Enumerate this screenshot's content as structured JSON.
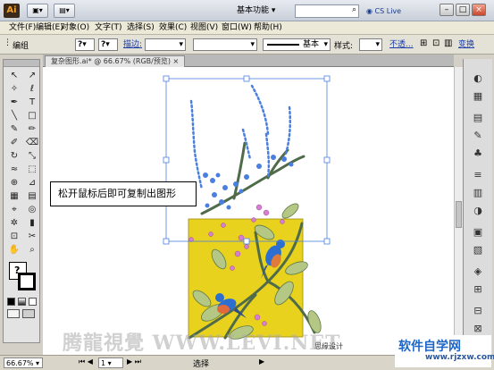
{
  "titlebar": {
    "logo": "Ai",
    "workspace": "基本功能",
    "cs_live": "CS Live"
  },
  "menu": [
    "文件(F)",
    "编辑(E)",
    "对象(O)",
    "文字(T)",
    "选择(S)",
    "效果(C)",
    "视图(V)",
    "窗口(W)",
    "帮助(H)"
  ],
  "control": {
    "group_label": "编组",
    "fill_q": "?",
    "stroke_q": "?",
    "stroke_label": "描边:",
    "line_profile": "基本",
    "style_label": "样式:",
    "opacity_link": "不透...",
    "transform_link": "变换"
  },
  "document_tab": "复杂图形.ai* @ 66.67% (RGB/预览)",
  "callout": "松开鼠标后即可复制出图形",
  "status": {
    "zoom": "66.67%",
    "page": "1",
    "selection": "选择",
    "credit": "思缘设计"
  },
  "watermark": "腾龍視覺 WWW.LEVI.NET",
  "site_badge": {
    "name": "软件自学网",
    "domain": "www.rjzxw.com"
  },
  "colors": {
    "accent": "#4a7fe0",
    "bird_blue": "#2c6fd0",
    "pattern_yellow": "#e8d21e"
  }
}
